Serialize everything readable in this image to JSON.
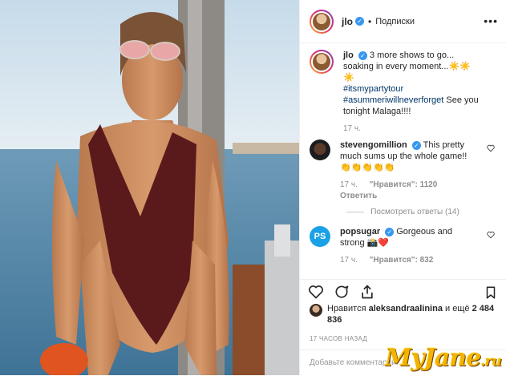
{
  "post": {
    "username": "jlo",
    "follow_label": "Подписки",
    "dot": "•",
    "more_icon": "more-horizontal-icon",
    "verified_icon": "verified-badge-icon"
  },
  "comments": [
    {
      "username": "jlo",
      "text": "3 more shows to go... soaking in every moment...☀️☀️☀️",
      "hashtag1": "#itsmypartytour",
      "hashtag2": "#asummeriwillneverforget",
      "text2": "See you tonight Malaga!!!!",
      "time": "17 ч."
    },
    {
      "username": "stevengomillion",
      "text": "This pretty much sums up the whole game!! 👏👏👏👏👏",
      "time": "17 ч.",
      "likes": "\"Нравится\": 1120",
      "reply": "Ответить",
      "view_replies": "Посмотреть ответы (14)"
    },
    {
      "username": "popsugar",
      "avatar_text": "PS",
      "text": "Gorgeous and strong 📸❤️",
      "time": "17 ч.",
      "likes": "\"Нравится\": 832"
    }
  ],
  "likes_line": {
    "prefix": "Нравится",
    "user": "aleksandraalinina",
    "suffix": "и ещё",
    "count": "2 484 836"
  },
  "timestamp": "17 ЧАСОВ НАЗАД",
  "add_comment_placeholder": "Добавьте комментарий...",
  "watermark": {
    "main": "MyJane",
    "suffix": ".ru"
  },
  "colors": {
    "accent": "#3897f0",
    "popsugar": "#1aa1e6",
    "swimsuit": "#5a1a1c"
  }
}
